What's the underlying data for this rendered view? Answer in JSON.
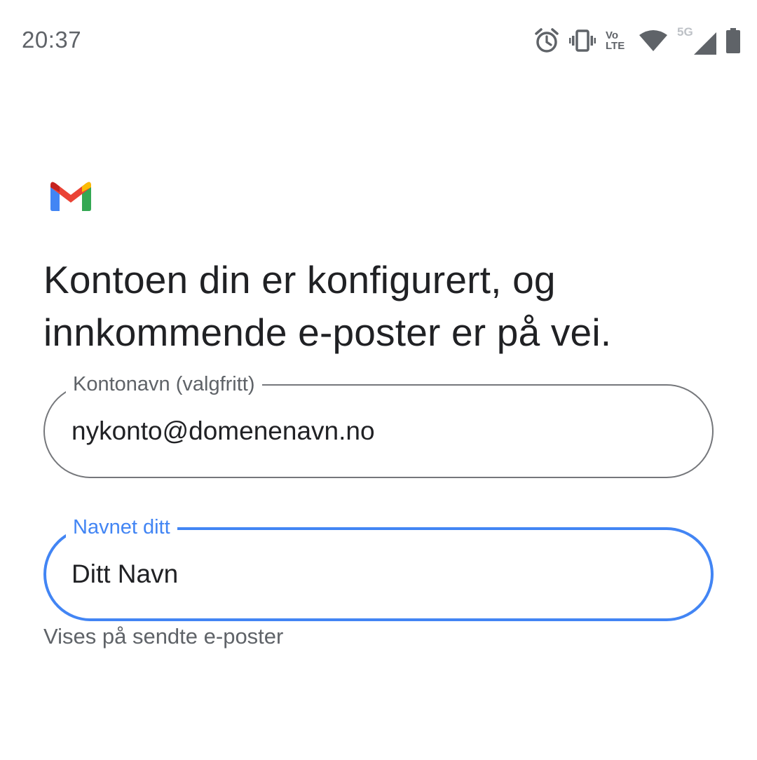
{
  "status_bar": {
    "time": "20:37",
    "icons": [
      "alarm-icon",
      "vibrate-icon",
      "volte-icon",
      "wifi-icon",
      "5g-signal-icon",
      "battery-icon"
    ],
    "volte_top": "Vo",
    "volte_bottom": "LTE",
    "network_label": "5G"
  },
  "app": {
    "logo": "gmail-logo"
  },
  "heading": "Kontoen din er konfigurert, og innkommende e-poster er på vei.",
  "form": {
    "account_name": {
      "label": "Kontonavn (valgfritt)",
      "value": "nykonto@domenenavn.no"
    },
    "your_name": {
      "label": "Navnet ditt",
      "value": "Ditt Navn",
      "helper": "Vises på sendte e-poster"
    }
  },
  "colors": {
    "focus": "#4285f4",
    "outline": "#75777b",
    "secondary_text": "#5f6368",
    "gmail_red": "#ea4335",
    "gmail_blue": "#4285f4",
    "gmail_green": "#34a853",
    "gmail_yellow": "#fbbc04",
    "gmail_dark_red": "#c5221f"
  }
}
